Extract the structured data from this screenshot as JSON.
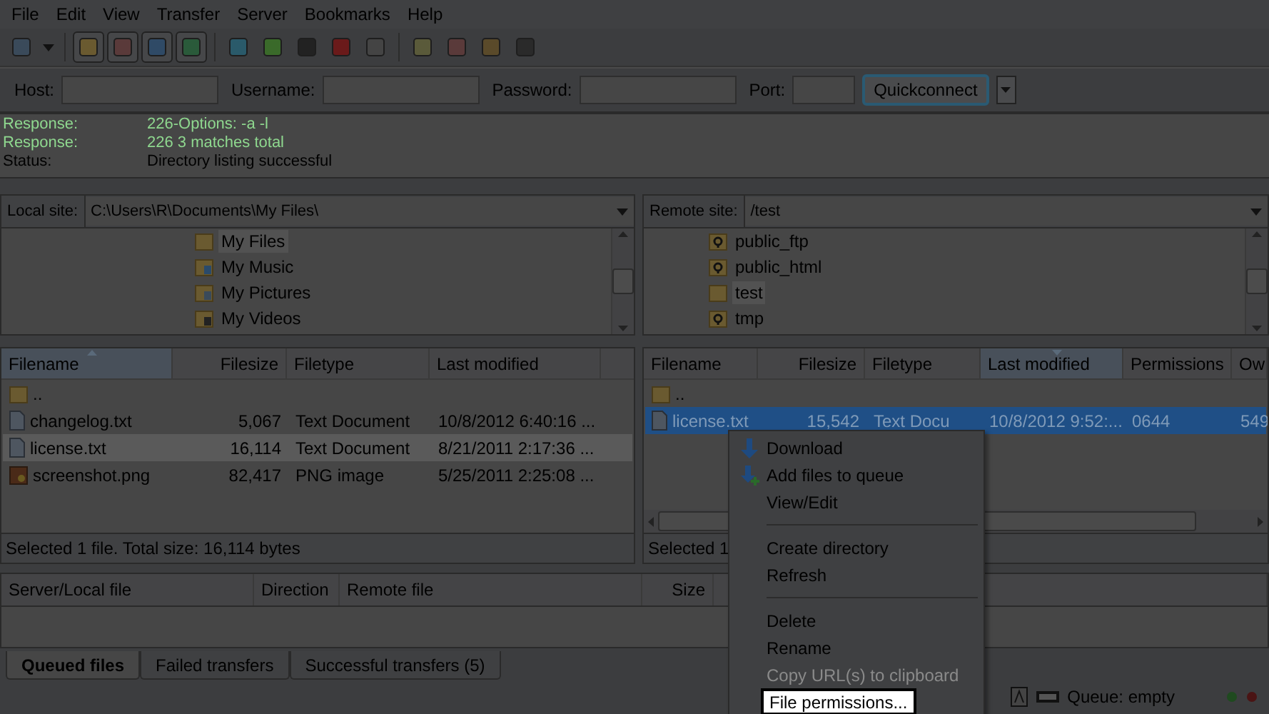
{
  "menu": [
    {
      "label": "File"
    },
    {
      "label": "Edit"
    },
    {
      "label": "View"
    },
    {
      "label": "Transfer"
    },
    {
      "label": "Server"
    },
    {
      "label": "Bookmarks"
    },
    {
      "label": "Help"
    }
  ],
  "toolbar": [
    {
      "kind": "site-manager",
      "pressed": false
    },
    {
      "kind": "dropdown",
      "pressed": false
    },
    {
      "kind": "separator"
    },
    {
      "kind": "log",
      "pressed": true
    },
    {
      "kind": "tree",
      "pressed": true
    },
    {
      "kind": "remote-tree",
      "pressed": true
    },
    {
      "kind": "queue",
      "pressed": true
    },
    {
      "kind": "separator"
    },
    {
      "kind": "refresh",
      "pressed": false
    },
    {
      "kind": "process",
      "pressed": false
    },
    {
      "kind": "flag",
      "pressed": false
    },
    {
      "kind": "cancel",
      "pressed": false
    },
    {
      "kind": "disconnect",
      "pressed": false
    },
    {
      "kind": "separator"
    },
    {
      "kind": "filter",
      "pressed": false
    },
    {
      "kind": "compare",
      "pressed": false
    },
    {
      "kind": "sync",
      "pressed": false
    },
    {
      "kind": "find",
      "pressed": false
    }
  ],
  "quickconnect": {
    "fields": [
      {
        "label": "Host:"
      },
      {
        "label": "Username:"
      },
      {
        "label": "Password:"
      },
      {
        "label": "Port:"
      }
    ],
    "button": "Quickconnect"
  },
  "log": [
    {
      "kind": "response",
      "label": "Response:",
      "text": "226-Options: -a -l"
    },
    {
      "kind": "response",
      "label": "Response:",
      "text": "226 3 matches total"
    },
    {
      "kind": "status",
      "label": "Status:",
      "text": "Directory listing successful"
    }
  ],
  "local": {
    "site_label": "Local site:",
    "path": "C:\\Users\\R\\Documents\\My Files\\",
    "tree": [
      {
        "name": "My Files",
        "kind": "folder",
        "selected": true
      },
      {
        "name": "My Music",
        "kind": "music",
        "selected": false
      },
      {
        "name": "My Pictures",
        "kind": "pictures",
        "selected": false
      },
      {
        "name": "My Videos",
        "kind": "videos",
        "selected": false
      }
    ],
    "columns": [
      {
        "label": "Filename",
        "sorted": true
      },
      {
        "label": "Filesize",
        "sorted": false
      },
      {
        "label": "Filetype",
        "sorted": false
      },
      {
        "label": "Last modified",
        "sorted": false
      }
    ],
    "rows": [
      {
        "kind": "folder",
        "selected": false,
        "cells": [
          ".."
        ]
      },
      {
        "kind": "text",
        "selected": false,
        "cells": [
          "changelog.txt",
          "5,067",
          "Text Document",
          "10/8/2012 6:40:16 ..."
        ]
      },
      {
        "kind": "text",
        "selected": true,
        "cells": [
          "license.txt",
          "16,114",
          "Text Document",
          "8/21/2011 2:17:36 ..."
        ]
      },
      {
        "kind": "image",
        "selected": false,
        "cells": [
          "screenshot.png",
          "82,417",
          "PNG image",
          "5/25/2011 2:25:08 ..."
        ]
      }
    ],
    "status": "Selected 1 file. Total size: 16,114 bytes"
  },
  "remote": {
    "site_label": "Remote site:",
    "path": "/test",
    "tree": [
      {
        "name": "public_ftp",
        "kind": "unknown",
        "selected": false
      },
      {
        "name": "public_html",
        "kind": "unknown",
        "selected": false
      },
      {
        "name": "test",
        "kind": "folder",
        "selected": true
      },
      {
        "name": "tmp",
        "kind": "unknown",
        "selected": false
      }
    ],
    "columns": [
      {
        "label": "Filename",
        "sorted": false
      },
      {
        "label": "Filesize",
        "sorted": false
      },
      {
        "label": "Filetype",
        "sorted": false
      },
      {
        "label": "Last modified",
        "sorted": true
      },
      {
        "label": "Permissions",
        "sorted": false
      },
      {
        "label": "Ow",
        "sorted": false
      }
    ],
    "rows": [
      {
        "kind": "folder",
        "selected": false,
        "cells": [
          ".."
        ]
      },
      {
        "kind": "text",
        "selected": true,
        "cells": [
          "license.txt",
          "15,542",
          "Text Docu",
          "10/8/2012 9:52:...",
          "0644",
          "549"
        ]
      }
    ],
    "status": "Selected 1"
  },
  "queue": {
    "columns": [
      {
        "label": "Server/Local file"
      },
      {
        "label": "Direction"
      },
      {
        "label": "Remote file"
      },
      {
        "label": "Size"
      }
    ],
    "tabs": [
      {
        "label": "Queued files",
        "selected": true
      },
      {
        "label": "Failed transfers",
        "selected": false
      },
      {
        "label": "Successful transfers (5)",
        "selected": false
      }
    ],
    "status": "Queue: empty"
  },
  "context_menu": [
    {
      "kind": "download",
      "label": "Download",
      "disabled": false,
      "highlighted": false
    },
    {
      "kind": "queue",
      "label": "Add files to queue",
      "disabled": false,
      "highlighted": false
    },
    {
      "kind": "item",
      "label": "View/Edit",
      "disabled": false,
      "highlighted": false
    },
    {
      "kind": "separator"
    },
    {
      "kind": "item",
      "label": "Create directory",
      "disabled": false,
      "highlighted": false
    },
    {
      "kind": "item",
      "label": "Refresh",
      "disabled": false,
      "highlighted": false
    },
    {
      "kind": "separator"
    },
    {
      "kind": "item",
      "label": "Delete",
      "disabled": false,
      "highlighted": false
    },
    {
      "kind": "item",
      "label": "Rename",
      "disabled": false,
      "highlighted": false
    },
    {
      "kind": "item",
      "label": "Copy URL(s) to clipboard",
      "disabled": true,
      "highlighted": false
    },
    {
      "kind": "item",
      "label": "File permissions...",
      "disabled": false,
      "highlighted": true
    }
  ]
}
